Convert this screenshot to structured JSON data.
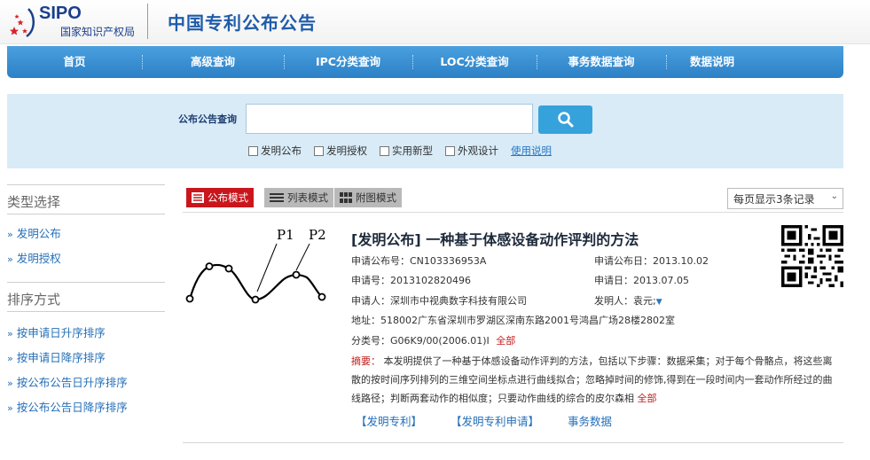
{
  "header": {
    "logo_text": "SIPO",
    "logo_cn": "国家知识产权局",
    "site_title": "中国专利公布公告"
  },
  "nav": {
    "items": [
      "首页",
      "高级查询",
      "IPC分类查询",
      "LOC分类查询",
      "事务数据查询",
      "数据说明"
    ]
  },
  "search": {
    "label": "公布公告查询",
    "value": "",
    "placeholder": "",
    "checkboxes": [
      "发明公布",
      "发明授权",
      "实用新型",
      "外观设计"
    ],
    "help_link": "使用说明"
  },
  "sidebar": {
    "type_heading": "类型选择",
    "type_items": [
      "发明公布",
      "发明授权"
    ],
    "sort_heading": "排序方式",
    "sort_items": [
      "按申请日升序排序",
      "按申请日降序排序",
      "按公布公告日升序排序",
      "按公布公告日降序排序"
    ]
  },
  "toolbar": {
    "modes": [
      "公布模式",
      "列表模式",
      "附图模式"
    ],
    "per_page": "每页显示3条记录"
  },
  "record": {
    "title": "[发明公布] 一种基于体感设备动作评判的方法",
    "pub_no": "申请公布号：CN103336953A",
    "pub_date": "申请公布日：2013.10.02",
    "app_no": "申请号：2013102820496",
    "app_date": "申请日：2013.07.05",
    "applicant": "申请人：深圳市中视典数字科技有限公司",
    "inventor": "发明人：袁元;",
    "address": "地址：518002广东省深圳市罗湖区深南东路2001号鸿昌广场28楼2802室",
    "class_no": "分类号：G06K9/00(2006.01)I",
    "class_all": "全部",
    "abstract_label": "摘要：",
    "abstract_text": "本发明提供了一种基于体感设备动作评判的方法，包括以下步骤：数据采集；对于每个骨骼点，将这些离散的按时间序列排列的三维空间坐标点进行曲线拟合；忽略掉时间的修饰,得到在一段时间内一套动作所经过的曲线路径；判断两套动作的相似度；只要动作曲线的综合的皮尔森相",
    "abstract_all": "全部",
    "links": [
      "【发明专利】",
      "【发明专利申请】",
      "事务数据"
    ],
    "figure_labels": [
      "P1",
      "P2"
    ]
  }
}
